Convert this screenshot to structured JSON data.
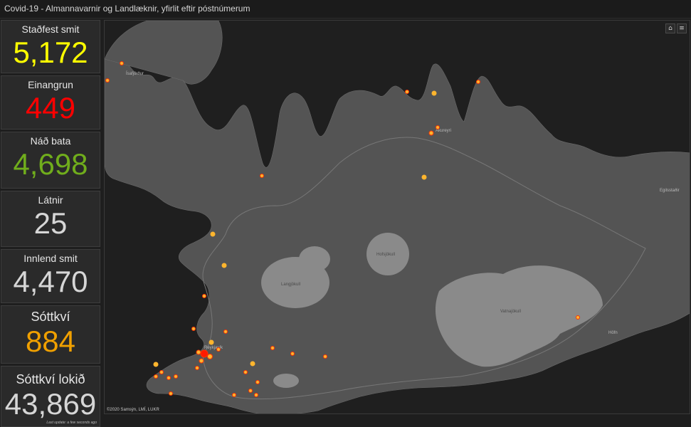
{
  "app": {
    "title": "Covid-19 - Almannavarnir og Landlæknir, yfirlit eftir póstnúmerum"
  },
  "stats": [
    {
      "label": "Staðfest smit",
      "value": "5,172",
      "color": "#ffff00"
    },
    {
      "label": "Einangrun",
      "value": "449",
      "color": "#ff0000"
    },
    {
      "label": "Náð bata",
      "value": "4,698",
      "color": "#70ad1c"
    },
    {
      "label": "Látnir",
      "value": "25",
      "color": "#d6d6d6"
    },
    {
      "label": "Innlend smit",
      "value": "4,470",
      "color": "#d6d6d6"
    },
    {
      "label": "Sóttkví",
      "value": "884",
      "color": "#f0a000"
    },
    {
      "label": "Sóttkví lokið",
      "value": "43,869",
      "color": "#d6d6d6"
    }
  ],
  "last_update": "Last update: a few seconds ago",
  "map": {
    "attribution": "©2020 Samsýn, LMÍ, LUKR",
    "home_icon": "home-icon",
    "list_icon": "list-icon",
    "place_labels": {
      "isafjordur": "Ísafjörður",
      "akureyri": "Akureyri",
      "egilsstadir": "Egilsstaðir",
      "hofsjokull": "Hofsjökull",
      "langjokull": "Langjökull",
      "vatnajokull": "Vatnajökull",
      "hofn": "Höfn",
      "reykjavik": "Reykjavík"
    },
    "colors": {
      "sea": "#1f1f1f",
      "land": "#545454",
      "glacier": "#8a8a8a",
      "marker_fill": "#ffb52e",
      "marker_stroke": "#ff3300",
      "marker_core": "#ff1a00"
    }
  }
}
